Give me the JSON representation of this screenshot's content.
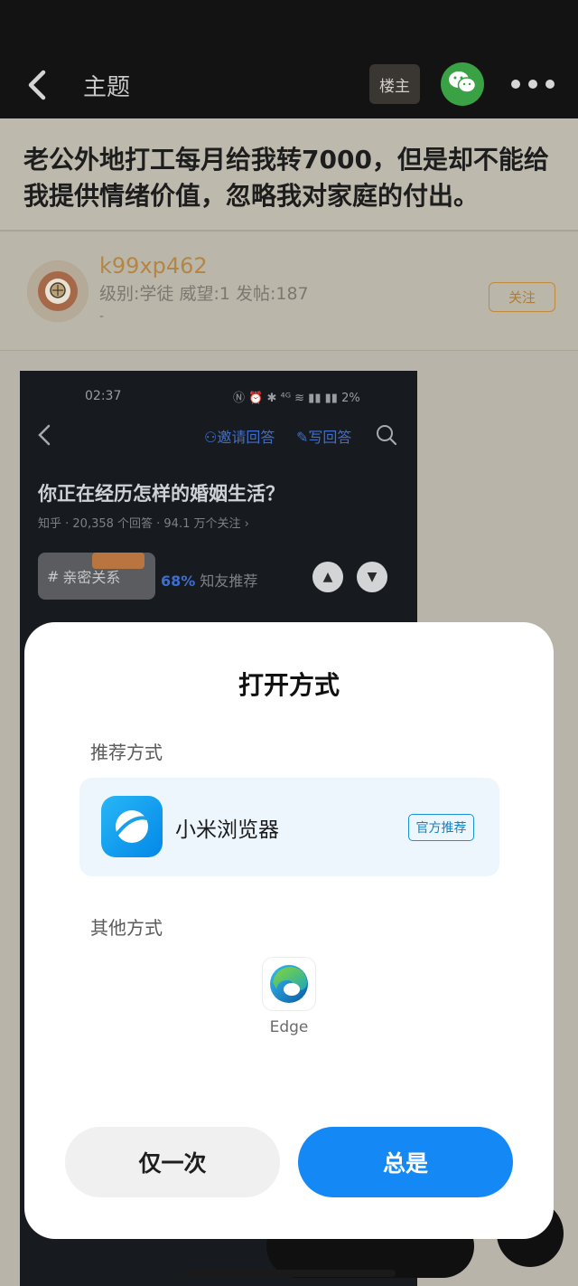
{
  "topbar": {
    "title": "主题",
    "op_badge": "楼主",
    "icons": [
      "back-icon",
      "wechat-icon",
      "more-icon"
    ]
  },
  "post": {
    "title": "老公外地打工每月给我转7000，但是却不能给我提供情绪价值，忽略我对家庭的付出。"
  },
  "author": {
    "name": "k99xp462",
    "stats": "级别:学徒 威望:1 发帖:187",
    "signature": "-",
    "follow_label": "关注"
  },
  "embedded_screenshot": {
    "time": "02:37",
    "status_text": "Ⓝ ⏰ ✱ ⁴ᴳ ≋ ▮▮ ▮▮ 2%",
    "invite_label": "邀请回答",
    "write_label": "写回答",
    "question": "你正在经历怎样的婚姻生活？",
    "meta": "知乎 · 20,358 个回答 · 94.1 万个关注 ›",
    "tag": "亲密关系",
    "tag_prefix": "#",
    "pct": "68%",
    "pct_suffix": " 知友推荐"
  },
  "dialog": {
    "title": "打开方式",
    "recommended_section": "推荐方式",
    "recommended_app": "小米浏览器",
    "recommended_badge": "官方推荐",
    "other_section": "其他方式",
    "other_app": "Edge",
    "once_button": "仅一次",
    "always_button": "总是"
  },
  "colors": {
    "primary_blue": "#1489f5",
    "badge_blue": "#1893d6",
    "author_orange": "#b48645",
    "wechat_green": "#3aa244"
  }
}
